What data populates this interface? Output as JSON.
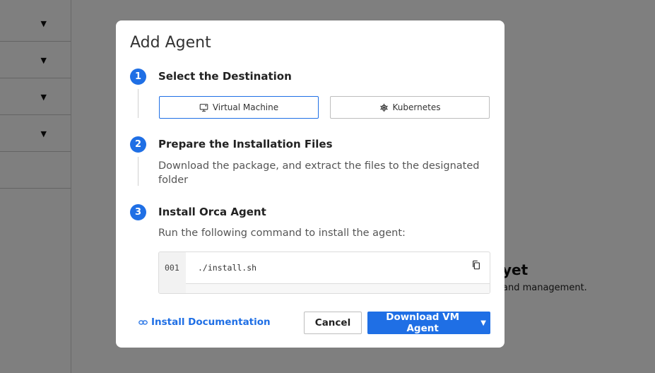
{
  "background": {
    "empty_title": "yet",
    "empty_subtitle": "and management.",
    "sidebar_caret": "▼"
  },
  "modal": {
    "title": "Add Agent",
    "steps": [
      {
        "number": "1",
        "title": "Select the Destination",
        "options": [
          {
            "label": "Virtual Machine",
            "icon": "monitor-icon",
            "selected": true
          },
          {
            "label": "Kubernetes",
            "icon": "kubernetes-icon",
            "selected": false
          }
        ]
      },
      {
        "number": "2",
        "title": "Prepare the Installation Files",
        "description": "Download the package, and extract the files to the designated folder"
      },
      {
        "number": "3",
        "title": "Install Orca Agent",
        "description": "Run the following command to install the agent:",
        "code": {
          "line_number": "001",
          "text": "./install.sh",
          "copy_icon": "copy-icon"
        }
      }
    ],
    "footer": {
      "doc_link": "Install Documentation",
      "doc_link_icon": "link-icon",
      "cancel": "Cancel",
      "primary": "Download VM Agent",
      "primary_caret": "▼"
    }
  },
  "colors": {
    "accent": "#1f6fe5",
    "overlay": "rgba(0,0,0,0.5)"
  }
}
